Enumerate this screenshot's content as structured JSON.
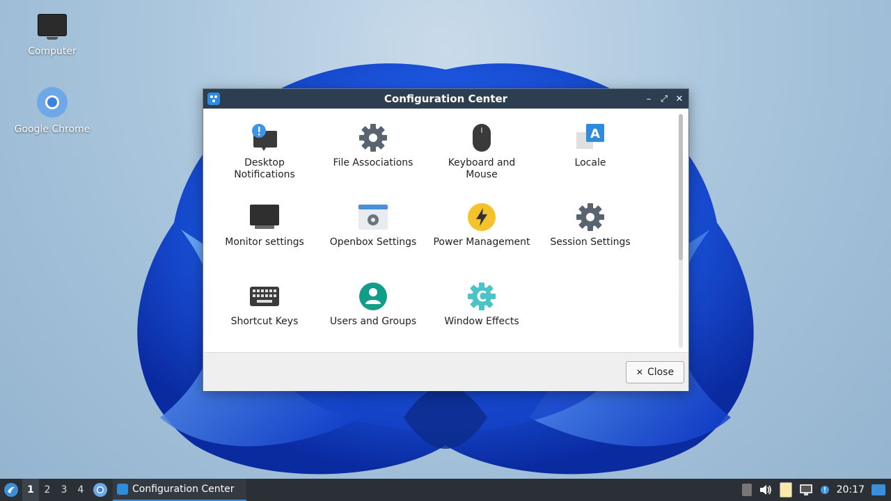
{
  "desktop": {
    "icons": [
      {
        "label": "Computer",
        "icon": "computer-icon"
      },
      {
        "label": "Google Chrome",
        "icon": "chrome-icon"
      }
    ]
  },
  "window": {
    "title": "Configuration Center",
    "controls": {
      "minimize": "–",
      "maximize": "⤢",
      "close": "✕"
    },
    "items": [
      {
        "label": "Desktop\nNotifications",
        "icon": "notification-icon"
      },
      {
        "label": "File Associations",
        "icon": "gear-icon"
      },
      {
        "label": "Keyboard and\nMouse",
        "icon": "mouse-icon"
      },
      {
        "label": "Locale",
        "icon": "locale-icon"
      },
      {
        "label": "Monitor settings",
        "icon": "monitor-icon"
      },
      {
        "label": "Openbox Settings",
        "icon": "openbox-icon"
      },
      {
        "label": "Power Management",
        "icon": "power-icon"
      },
      {
        "label": "Session Settings",
        "icon": "gear-icon"
      },
      {
        "label": "Shortcut Keys",
        "icon": "keyboard-icon"
      },
      {
        "label": "Users and Groups",
        "icon": "user-icon"
      },
      {
        "label": "Window Effects",
        "icon": "window-effects-icon"
      }
    ],
    "close_label": "Close"
  },
  "taskbar": {
    "workspaces": [
      "1",
      "2",
      "3",
      "4"
    ],
    "active_workspace": "1",
    "task_label": "Configuration Center",
    "clock": "20:17"
  },
  "colors": {
    "titlebar": "#2c3e50",
    "taskbar": "#2b3036",
    "accent": "#2f8bdc"
  }
}
